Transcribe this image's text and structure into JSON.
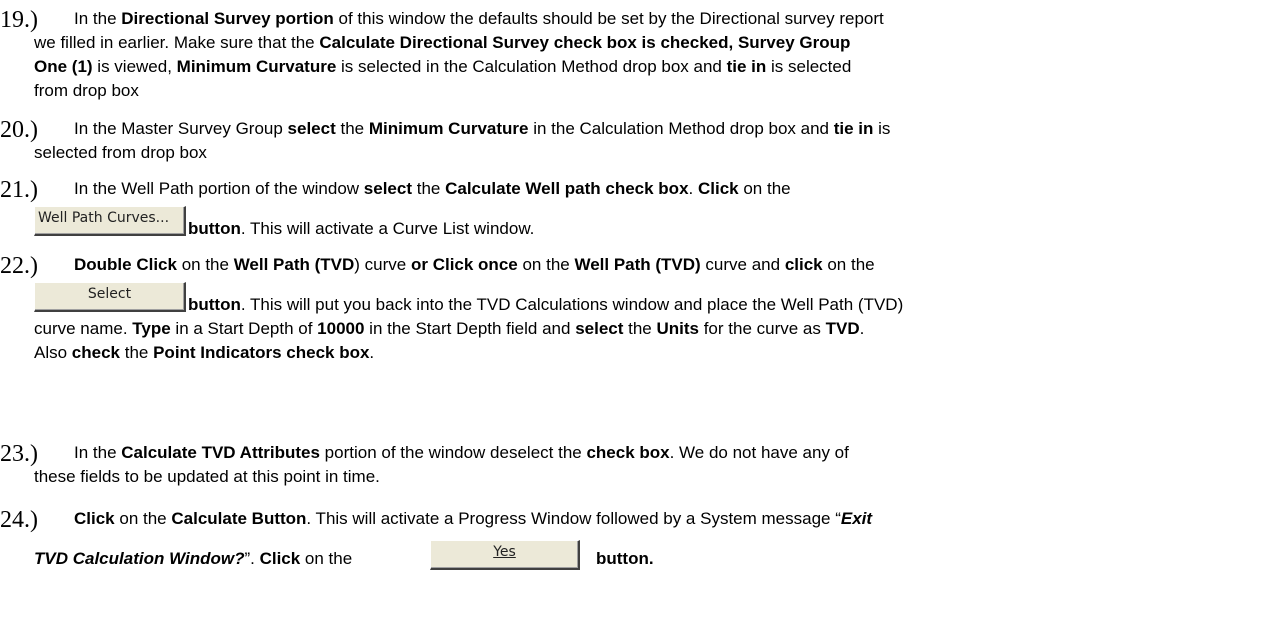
{
  "steps": [
    {
      "number": "19.)",
      "lines": [
        [
          [
            "In the ",
            ""
          ],
          [
            "Directional Survey portion",
            "b"
          ],
          [
            " of this window the defaults should be set by the Directional survey report",
            ""
          ]
        ],
        [
          [
            "we filled in earlier. Make sure that the ",
            ""
          ],
          [
            "Calculate Directional Survey check box is checked, Survey Group",
            "b"
          ]
        ],
        [
          [
            "One (1)",
            "b"
          ],
          [
            " is viewed, ",
            ""
          ],
          [
            "Minimum Curvature",
            "b"
          ],
          [
            " is selected in the Calculation Method drop box and ",
            ""
          ],
          [
            "tie in",
            "b"
          ],
          [
            " is selected",
            ""
          ]
        ],
        [
          [
            "from drop box",
            ""
          ]
        ]
      ]
    },
    {
      "number": "20.)",
      "lines": [
        [
          [
            "In the Master Survey Group ",
            ""
          ],
          [
            "select",
            "b"
          ],
          [
            " the ",
            ""
          ],
          [
            "Minimum Curvature",
            "b"
          ],
          [
            " in the Calculation Method drop box and ",
            ""
          ],
          [
            "tie in",
            "b"
          ],
          [
            " is",
            ""
          ]
        ],
        [
          [
            "selected from drop box",
            ""
          ]
        ]
      ]
    },
    {
      "number": "21.)",
      "lines": [
        [
          [
            "In the Well Path portion of the window ",
            ""
          ],
          [
            "select",
            "b"
          ],
          [
            " the ",
            ""
          ],
          [
            "Calculate Well path check box",
            "b"
          ],
          [
            ". ",
            ""
          ],
          [
            "Click",
            "b"
          ],
          [
            " on the",
            ""
          ]
        ],
        [
          [
            "button",
            "b"
          ],
          [
            ". This will activate a Curve List window.",
            ""
          ]
        ]
      ]
    },
    {
      "number": "22.)",
      "lines": [
        [
          [
            "Double Click",
            "b"
          ],
          [
            " on the ",
            ""
          ],
          [
            "Well Path (TVD",
            "b"
          ],
          [
            ") curve ",
            ""
          ],
          [
            "or Click once",
            "b"
          ],
          [
            " on the ",
            ""
          ],
          [
            "Well Path (TVD)",
            "b"
          ],
          [
            " curve and ",
            ""
          ],
          [
            "click",
            "b"
          ],
          [
            " on the",
            ""
          ]
        ],
        [
          [
            "button",
            "b"
          ],
          [
            ". This will put you back into the TVD Calculations window and place the Well Path (TVD)",
            ""
          ]
        ],
        [
          [
            "curve name. ",
            ""
          ],
          [
            "Type",
            "b"
          ],
          [
            " in a Start Depth of ",
            ""
          ],
          [
            "10000",
            "b"
          ],
          [
            " in the Start Depth field and ",
            ""
          ],
          [
            "select",
            "b"
          ],
          [
            " the ",
            ""
          ],
          [
            "Units",
            "b"
          ],
          [
            " for the curve as ",
            ""
          ],
          [
            "TVD",
            "b"
          ],
          [
            ".",
            ""
          ]
        ],
        [
          [
            "Also ",
            ""
          ],
          [
            "check",
            "b"
          ],
          [
            " the ",
            ""
          ],
          [
            "Point Indicators check box",
            "b"
          ],
          [
            ".",
            ""
          ]
        ]
      ]
    },
    {
      "number": "23.)",
      "lines": [
        [
          [
            "In the ",
            ""
          ],
          [
            "Calculate TVD Attributes",
            "b"
          ],
          [
            " portion of the window deselect the ",
            ""
          ],
          [
            "check box",
            "b"
          ],
          [
            ". We do not have any of",
            ""
          ]
        ],
        [
          [
            "these fields to be updated at this point in time.",
            ""
          ]
        ]
      ]
    },
    {
      "number": "24.)",
      "lines": [
        [
          [
            "Click",
            "b"
          ],
          [
            " on the ",
            ""
          ],
          [
            "Calculate Button",
            "b"
          ],
          [
            ". This will activate a Progress Window followed by a System message “",
            ""
          ],
          [
            "Exit",
            "bi"
          ]
        ],
        [
          [
            "TVD Calculation Window?",
            "bi"
          ],
          [
            "”. ",
            ""
          ],
          [
            "Click",
            "b"
          ],
          [
            " on the",
            ""
          ],
          [
            "button.",
            "b"
          ]
        ]
      ]
    }
  ],
  "buttons": {
    "well_path_curves": "Well Path Curves...",
    "select": "Select",
    "yes": "Yes"
  }
}
